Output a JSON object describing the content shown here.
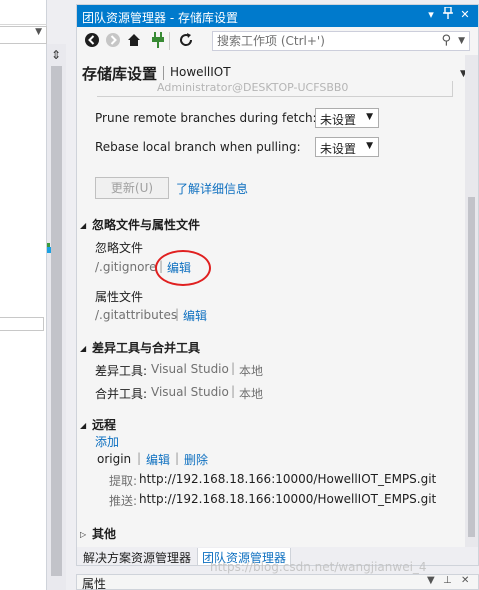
{
  "left_pane": {
    "split_icon": "split-icon"
  },
  "window": {
    "title": "团队资源管理器 - 存储库设置",
    "title_buttons": {
      "dropdown": "▾",
      "pin": "📌",
      "close": "✕"
    }
  },
  "toolbar": {
    "back_icon": "back-arrow-icon",
    "forward_icon": "forward-arrow-icon",
    "home_icon": "home-icon",
    "connect_icon": "plug-icon",
    "refresh_icon": "refresh-icon",
    "search_placeholder": "搜索工作项 (Ctrl+')",
    "search_icon": "magnifier-icon"
  },
  "page": {
    "title": "存储库设置",
    "repo_name": "HowellIOT",
    "ghost_email": "Administrator@DESKTOP-UCFSBB0"
  },
  "git_settings": {
    "prune_label": "Prune remote branches during fetch:",
    "prune_value": "未设置",
    "rebase_label": "Rebase local branch when pulling:",
    "rebase_value": "未设置",
    "update_button": "更新(U)",
    "learn_more": "了解详细信息"
  },
  "ignore_section": {
    "title": "忽略文件与属性文件",
    "ignore_label": "忽略文件",
    "ignore_file": "/.gitignore",
    "ignore_edit": "编辑",
    "attr_label": "属性文件",
    "attr_file": "/.gitattributes",
    "attr_edit": "编辑",
    "separator": "|"
  },
  "diff_section": {
    "title": "差异工具与合并工具",
    "diff_label": "差异工具:",
    "diff_tool": "Visual Studio",
    "diff_scope": "本地",
    "merge_label": "合并工具:",
    "merge_tool": "Visual Studio",
    "merge_scope": "本地"
  },
  "remotes_section": {
    "title": "远程",
    "add": "添加",
    "remote_name": "origin",
    "edit": "编辑",
    "delete": "删除",
    "fetch_label": "提取:",
    "fetch_url": "http://192.168.18.166:10000/HowellIOT_EMPS.git",
    "push_label": "推送:",
    "push_url": "http://192.168.18.166:10000/HowellIOT_EMPS.git"
  },
  "other_section": {
    "title": "其他"
  },
  "bottom_tabs": [
    {
      "label": "解决方案资源管理器"
    },
    {
      "label": "团队资源管理器"
    }
  ],
  "properties_panel": {
    "title": "属性"
  },
  "watermark": "https://blog.csdn.net/wangjianwei_4"
}
